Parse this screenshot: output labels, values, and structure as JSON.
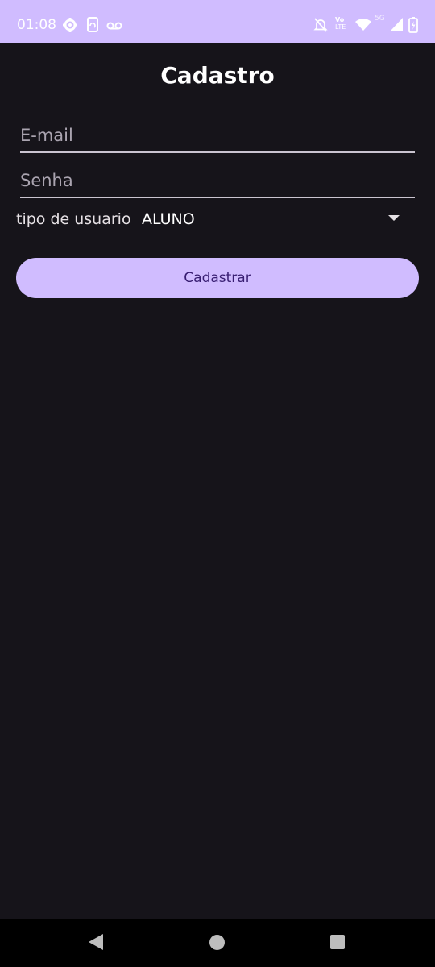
{
  "status_bar": {
    "time": "01:08",
    "icons": [
      "settings-icon",
      "phone-sync-icon",
      "voicemail-icon",
      "do-not-disturb-icon",
      "volte-icon",
      "wifi-icon",
      "signal-5g-icon",
      "battery-icon"
    ],
    "volte_top": "Vo",
    "volte_bottom": "LTE",
    "network": "5G",
    "background_color": "#d0bcff"
  },
  "page": {
    "title": "Cadastro",
    "background_color": "#16141a"
  },
  "form": {
    "email": {
      "placeholder": "E-mail",
      "value": ""
    },
    "password": {
      "placeholder": "Senha",
      "value": ""
    },
    "user_type": {
      "label": "tipo de usuario",
      "selected": "ALUNO"
    },
    "submit_label": "Cadastrar",
    "accent_color": "#d0bcff"
  },
  "nav_bar": {
    "icons": [
      "back-icon",
      "home-icon",
      "recents-icon"
    ]
  }
}
